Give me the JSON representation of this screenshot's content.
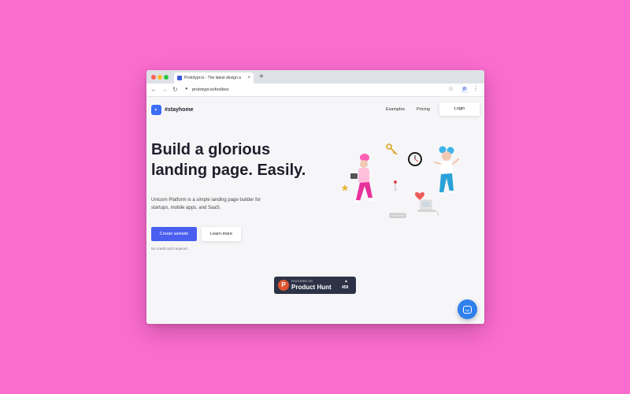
{
  "browser": {
    "tab": {
      "title": "Prototypr.io - The latest design a",
      "close": "×"
    },
    "new_tab": "+",
    "url": "prototypr.io/toolbox",
    "extension_label": "P"
  },
  "site": {
    "brand": "#stayhome",
    "nav": {
      "examples": "Examples",
      "pricing": "Pricing",
      "login": "Login"
    },
    "hero": {
      "title": "Build a glorious landing page. Easily.",
      "subtitle": "Unicorn Platform is a simple landing page builder for startups, mobile apps, and SaaS.",
      "cta_primary": "Create website",
      "cta_secondary": "Learn more",
      "note": "No credit card required."
    },
    "product_hunt": {
      "featured": "FEATURED ON",
      "name": "Product Hunt",
      "count": "459"
    }
  },
  "colors": {
    "background": "#fb6ccf",
    "accent": "#4a5ff0",
    "chat_button": "#2f80ed",
    "product_hunt": "#da552f"
  },
  "icons": [
    "back-arrow-icon",
    "forward-arrow-icon",
    "reload-icon",
    "lock-icon",
    "star-icon",
    "more-menu-icon",
    "chat-icon"
  ]
}
